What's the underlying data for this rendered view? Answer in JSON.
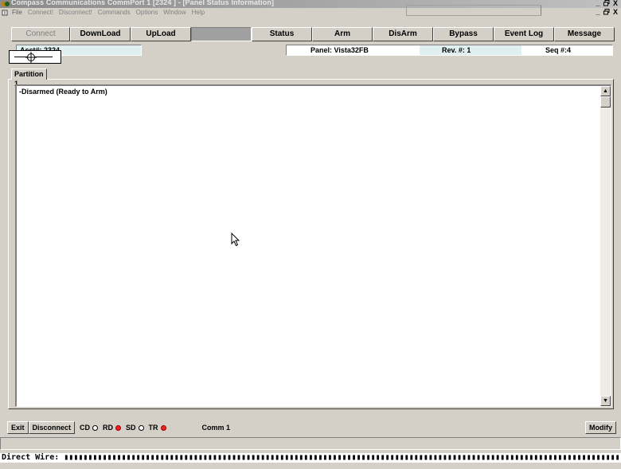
{
  "window": {
    "title": "Compass Communications CommPort 1 [2324 ] - [Panel Status Information]",
    "controls": [
      "_",
      " ",
      "X"
    ]
  },
  "menu": {
    "items": [
      "File",
      "Connect!",
      "Disconnect!",
      "Commands",
      "Options",
      "Window",
      "Help"
    ]
  },
  "toolbar": {
    "buttons": [
      {
        "label": "Connect",
        "disabled": true
      },
      {
        "label": "DownLoad"
      },
      {
        "label": "UpLoad"
      },
      {
        "label": ""
      },
      {
        "label": "Status"
      },
      {
        "label": "Arm"
      },
      {
        "label": "DisArm"
      },
      {
        "label": "Bypass"
      },
      {
        "label": "Event Log"
      },
      {
        "label": "Message"
      }
    ]
  },
  "info": {
    "account": "Acct#: 2324",
    "panel": "Panel: Vista32FB",
    "rev": "Rev. #: 1",
    "seq": "Seq #:4"
  },
  "tabs": [
    {
      "label": "Partition 1",
      "selected": true
    }
  ],
  "status_list": {
    "lines": [
      "-Disarmed  (Ready to Arm)"
    ]
  },
  "bottom": {
    "exit_label": "Exit",
    "disconnect_label": "Disconnect",
    "indicators": [
      {
        "label": "CD",
        "state": "off"
      },
      {
        "label": "RD",
        "state": "on"
      },
      {
        "label": "SD",
        "state": "off"
      },
      {
        "label": "TR",
        "state": "on"
      }
    ],
    "comm_label": "Comm 1",
    "modify_label": "Modify"
  },
  "direct_wire": {
    "label": "Direct Wire:",
    "bar_text": "▮▮▮▮▮▮▮▮▮▮▮▮▮▮▮▮▮▮▮▮▮▮▮▮▮▮▮▮▮▮▮▮▮▮▮▮▮▮▮▮▮▮▮▮▮▮▮▮▮▮▮▮▮▮▮▮▮▮▮▮▮▮▮▮▮▮▮▮▮▮▮▮▮▮▮▮▮▮▮▮▮▮▮▮▮▮▮▮▮▮▮▮▮▮▮▮▮▮▮▮▮▮▮▮▮▮▮▮▮▮▮▮▮▮▮▮▮▮▮▮▮▮▮▮▮▮▮▮▮▮▮▮▮▮▮▮▮▮▮▮▮▮▮▮▮▮▮▮▮▮▮▮▮▮▮▮▮▮"
  },
  "colors": {
    "face": "#d4d0c8",
    "indicator_on": "#ee2222",
    "info_cell": "#e0f0f0"
  }
}
